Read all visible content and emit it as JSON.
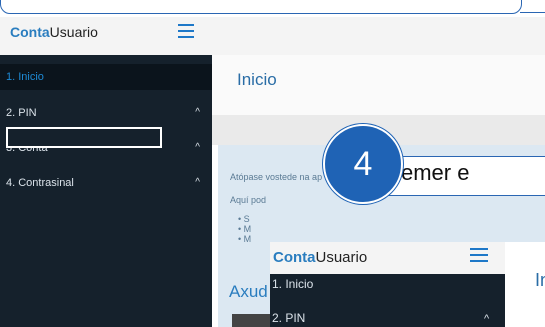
{
  "header": {
    "brand_bold": "Conta",
    "brand_rest": "Usuario"
  },
  "sidebar": {
    "items": [
      {
        "label": "1. Inicio",
        "active": true
      },
      {
        "label": "2. PIN",
        "chevron": "^"
      },
      {
        "label": "3. Conta",
        "chevron": "^"
      },
      {
        "label": "4. Contrasinal",
        "chevron": "^"
      }
    ]
  },
  "main": {
    "title": "Inicio",
    "panel": {
      "line1": "Atópase vostede na ap",
      "line2": "Aquí pod",
      "bullets": [
        "S",
        "M",
        "M"
      ],
      "heading": "Axud"
    }
  },
  "inset": {
    "brand_bold": "Conta",
    "brand_rest": "Usuario",
    "items": [
      {
        "label": "1. Inicio"
      },
      {
        "label": "2. PIN",
        "chevron": "^"
      }
    ],
    "title": "In"
  },
  "callout": {
    "step": "4",
    "text": "Premer e"
  },
  "colors": {
    "accent": "#1f63b5",
    "sidebar_bg": "#15212c",
    "active_text": "#1e8bd6"
  }
}
